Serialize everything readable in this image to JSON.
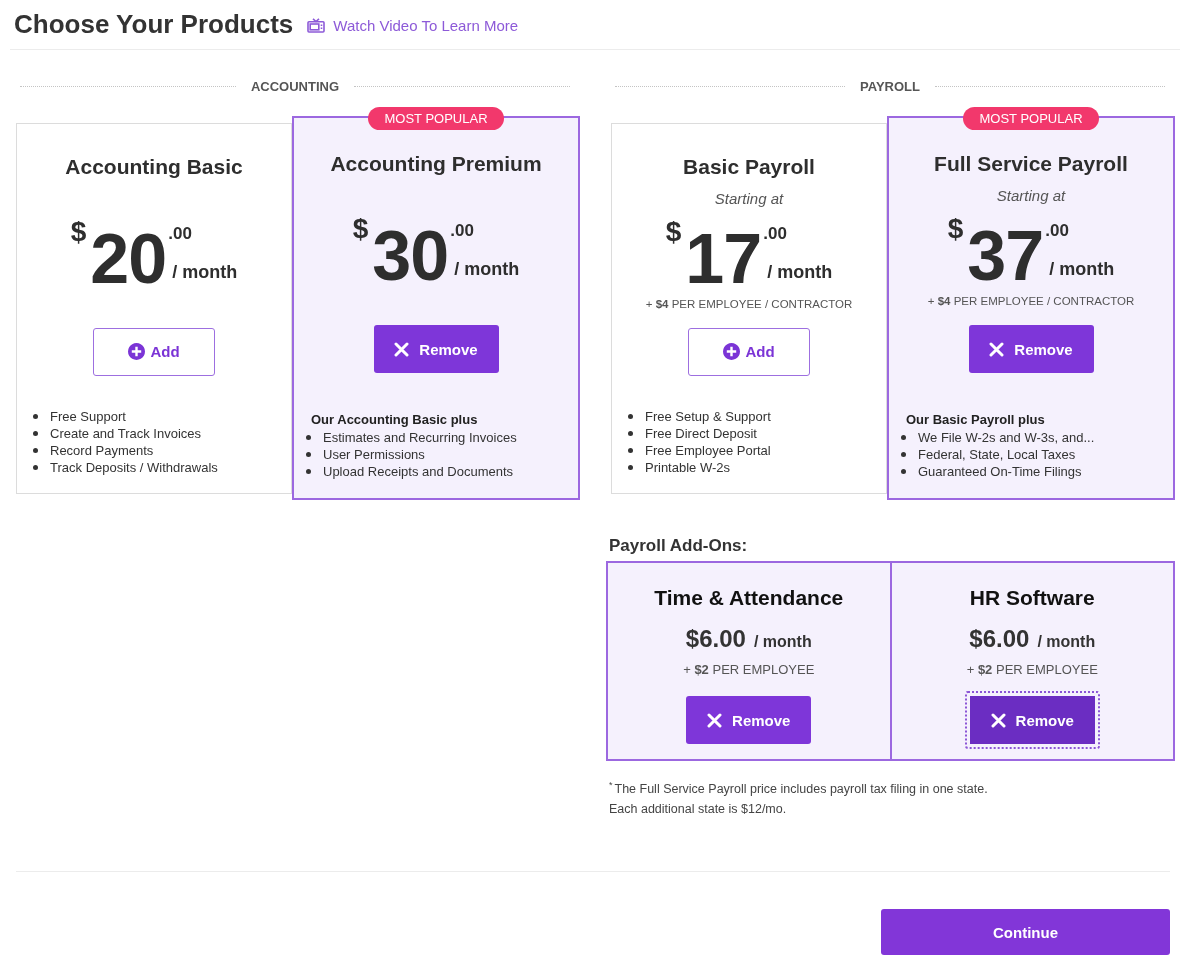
{
  "header": {
    "title": "Choose Your Products",
    "video_link": "Watch Video To Learn More"
  },
  "sections": [
    {
      "label": "ACCOUNTING",
      "plans": [
        {
          "name": "Accounting Basic",
          "selected": false,
          "price": {
            "currency": "$",
            "amount": "20",
            "cents": ".00",
            "period": "/ month"
          },
          "button": "Add",
          "features": [
            "Free Support",
            "Create and Track Invoices",
            "Record Payments",
            "Track Deposits / Withdrawals"
          ]
        },
        {
          "name": "Accounting Premium",
          "selected": true,
          "badge": "MOST POPULAR",
          "price": {
            "currency": "$",
            "amount": "30",
            "cents": ".00",
            "period": "/ month"
          },
          "button": "Remove",
          "features_heading": "Our Accounting Basic plus",
          "features": [
            "Estimates and Recurring Invoices",
            "User Permissions",
            "Upload Receipts and Documents"
          ]
        }
      ]
    },
    {
      "label": "PAYROLL",
      "plans": [
        {
          "name": "Basic Payroll",
          "selected": false,
          "subtitle": "Starting at",
          "price": {
            "currency": "$",
            "amount": "17",
            "cents": ".00",
            "period": "/ month"
          },
          "extra": "+ **$4** PER EMPLOYEE / CONTRACTOR",
          "button": "Add",
          "features": [
            "Free Setup & Support",
            "Free Direct Deposit",
            "Free Employee Portal",
            "Printable W-2s"
          ]
        },
        {
          "name": "Full Service Payroll",
          "selected": true,
          "badge": "MOST POPULAR",
          "subtitle": "Starting at",
          "price": {
            "currency": "$",
            "amount": "37",
            "cents": ".00",
            "period": "/ month"
          },
          "extra": "+ **$4** PER EMPLOYEE / CONTRACTOR",
          "button": "Remove",
          "features_heading": "Our Basic Payroll plus",
          "features": [
            "We File W-2s and W-3s, and...",
            "Federal, State, Local Taxes",
            "Guaranteed On-Time Filings"
          ]
        }
      ],
      "addons": {
        "title": "Payroll Add-Ons:",
        "items": [
          {
            "name": "Time & Attendance",
            "selected": true,
            "price": "$6.00",
            "period": "/ month",
            "extra": "+ **$2** PER EMPLOYEE",
            "button": "Remove",
            "focused": false
          },
          {
            "name": "HR Software",
            "selected": true,
            "price": "$6.00",
            "period": "/ month",
            "extra": "+ **$2** PER EMPLOYEE",
            "button": "Remove",
            "focused": true
          }
        ],
        "footnote": [
          "$^{*}$The Full Service Payroll price includes payroll tax filing in one state.",
          "Each additional state is $12/mo."
        ]
      }
    }
  ],
  "continue_button": "Continue"
}
